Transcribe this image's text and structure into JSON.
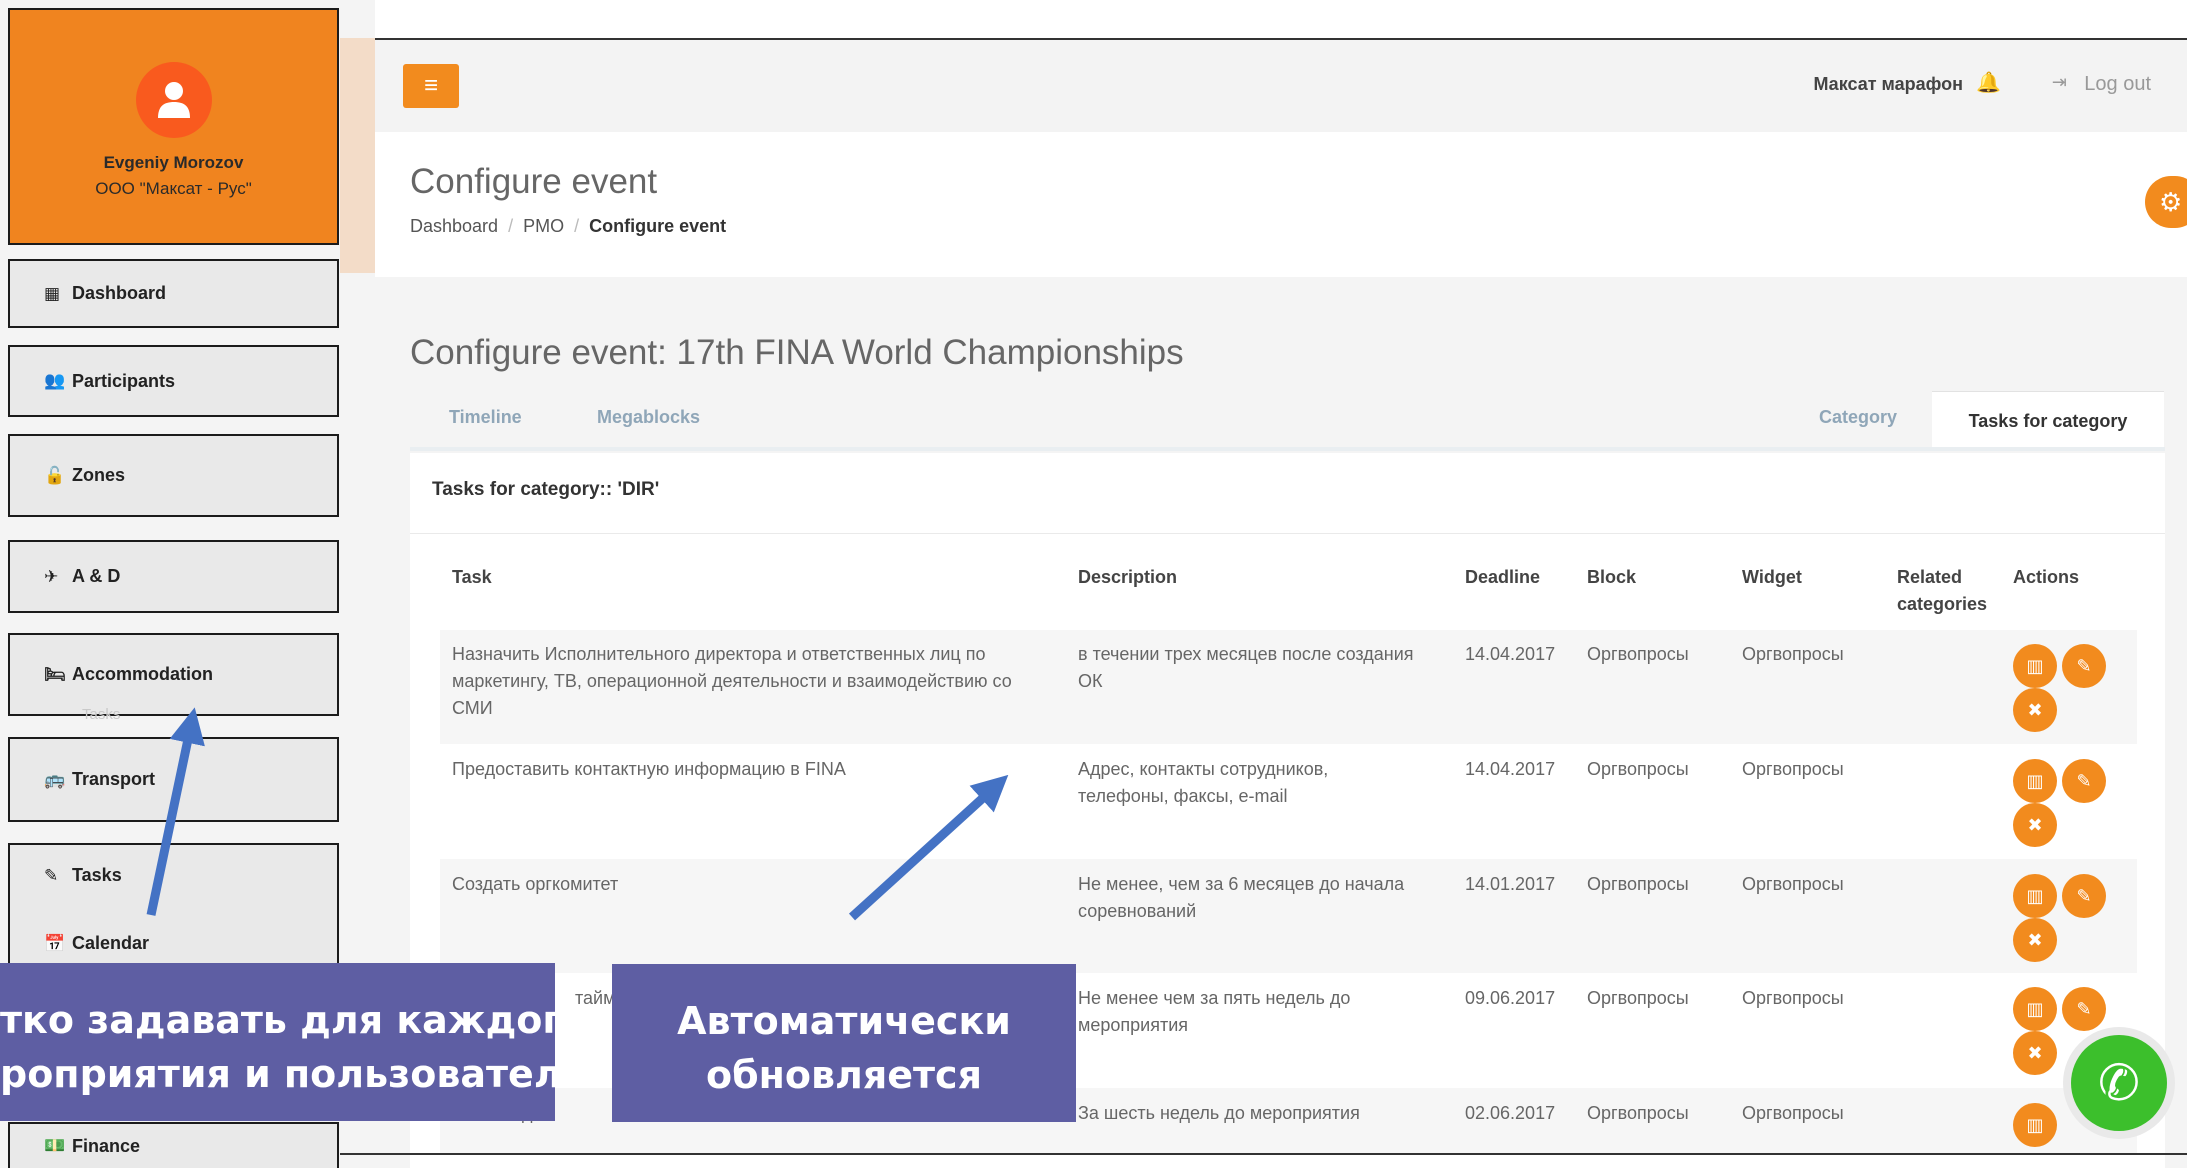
{
  "profile": {
    "name": "Evgeniy Morozov",
    "org": "ООО \"Максат - Рус\"",
    "icon": "user-icon"
  },
  "sidebar": {
    "items": [
      {
        "label": "Dashboard",
        "icon": "dashboard-icon",
        "glyph": "▦"
      },
      {
        "label": "Participants",
        "icon": "users-icon",
        "glyph": "👥"
      },
      {
        "label": "Zones",
        "icon": "unlock-icon",
        "glyph": "🔓"
      },
      {
        "label": "A & D",
        "icon": "plane-icon",
        "glyph": "✈"
      },
      {
        "label": "Accommodation",
        "icon": "bed-icon",
        "glyph": "🛏"
      },
      {
        "label": "Transport",
        "icon": "bus-icon",
        "glyph": "🚌"
      },
      {
        "label": "Tasks",
        "icon": "pencil-icon",
        "glyph": "✎"
      },
      {
        "label": "Calendar",
        "icon": "calendar-icon",
        "glyph": "📅"
      },
      {
        "label": "Finance",
        "icon": "money-icon",
        "glyph": "💵"
      }
    ],
    "ghost_tasks": "Tasks"
  },
  "topbar": {
    "menu_glyph": "≡",
    "user": "Максат марафон",
    "logout": "Log out"
  },
  "header": {
    "title": "Configure event",
    "breadcrumb": [
      "Dashboard",
      "PMO",
      "Configure event"
    ]
  },
  "content": {
    "event_title": "Configure event: 17th FINA World Championships",
    "tabs": [
      "Timeline",
      "Megablocks",
      "Category",
      "Tasks for category"
    ],
    "panel_title": "Tasks for category:: 'DIR'",
    "columns": [
      "Task",
      "Description",
      "Deadline",
      "Block",
      "Widget",
      "Related categories",
      "Actions"
    ],
    "rows": [
      {
        "task": "Назначить Исполнительного директора и ответственных лиц по маркетингу, ТВ, операционной деятельности и взаимодействию со СМИ",
        "description": "в течении трех месяцев после создания ОК",
        "deadline": "14.04.2017",
        "block": "Оргвопросы",
        "widget": "Оргвопросы",
        "related": ""
      },
      {
        "task": "Предоставить контактную информацию в FINA",
        "description": "Адрес, контакты сотрудников, телефоны, факсы, e-mail",
        "deadline": "14.04.2017",
        "block": "Оргвопросы",
        "widget": "Оргвопросы",
        "related": ""
      },
      {
        "task": "Создать оргкомитет",
        "description": "Не менее, чем за 6 месяцев до начала соревнований",
        "deadline": "14.01.2017",
        "block": "Оргвопросы",
        "widget": "Оргвопросы",
        "related": ""
      },
      {
        "task": "таймин",
        "description": "Не менее чем за пять недель до мероприятия",
        "deadline": "09.06.2017",
        "block": "Оргвопросы",
        "widget": "Оргвопросы",
        "related": ""
      },
      {
        "task": "ть пода",
        "description": "За шесть недель до мероприятия",
        "deadline": "02.06.2017",
        "block": "Оргвопросы",
        "widget": "Оргвопросы",
        "related": ""
      }
    ]
  },
  "overlays": {
    "callout_left": [
      "тко задавать для каждого",
      "роприятия и пользователя"
    ],
    "callout_right": [
      "Автоматически",
      "обновляется"
    ],
    "phone_icon": "phone-icon"
  },
  "colors": {
    "accent": "#f28b1e",
    "profile_bg": "#f0841f",
    "avatar": "#f95a1e",
    "callout": "#5e5ea3",
    "arrow": "#4472c4",
    "phone": "#3cbf2c"
  }
}
